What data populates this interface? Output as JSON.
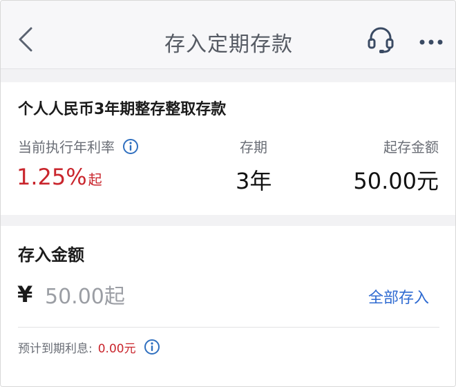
{
  "header": {
    "title": "存入定期存款"
  },
  "product": {
    "name": "个人人民币3年期整存整取存款",
    "rate_label": "当前执行年利率",
    "term_label": "存期",
    "min_label": "起存金额",
    "rate_value": "1.25%",
    "rate_suffix": "起",
    "term_value": "3年",
    "min_value": "50.00元"
  },
  "deposit": {
    "title": "存入金额",
    "currency_symbol": "¥",
    "amount_placeholder": "50.00起",
    "amount_value": "",
    "deposit_all_label": "全部存入",
    "interest_label": "预计到期利息:",
    "interest_value": "0.00元"
  },
  "colors": {
    "accent_red": "#c9252c",
    "link_blue": "#2e6ad1",
    "icon_blue": "#2f6fbf"
  },
  "icons": [
    "chevron-left-icon",
    "headset-icon",
    "more-dots-icon",
    "info-icon"
  ]
}
